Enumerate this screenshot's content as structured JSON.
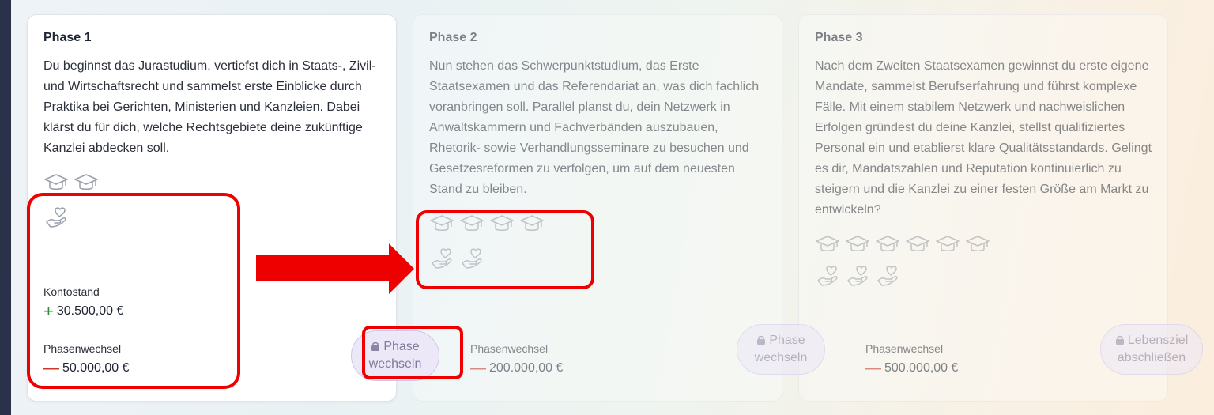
{
  "phases": [
    {
      "title": "Phase 1",
      "text": "Du beginnst das Jurastudium, vertiefst dich in Staats-, Zivil- und Wirtschaftsrecht und sammelst erste Einblicke durch Praktika bei Gerichten, Ministerien und Kanzleien. Dabei klärst du für dich, welche Rechtsgebiete deine zukünftige Kanzlei abdecken soll.",
      "grad_caps": 2,
      "handshakes": 1,
      "balance_label": "Kontostand",
      "balance_value": "30.500,00 €",
      "change_label": "Phasenwechsel",
      "change_value": "50.000,00 €"
    },
    {
      "title": "Phase 2",
      "text": "Nun stehen das Schwerpunktstudium, das Erste Staatsexamen und das Referendariat an, was dich fachlich voranbringen soll. Parallel planst du, dein Netzwerk in Anwaltskammern und Fachverbänden auszubauen, Rhetorik- sowie Verhandlungsseminare zu besuchen und Gesetzesreformen zu verfolgen, um auf dem neuesten Stand zu bleiben.",
      "grad_caps": 4,
      "handshakes": 2,
      "change_label": "Phasenwechsel",
      "change_value": "200.000,00 €"
    },
    {
      "title": "Phase 3",
      "text": "Nach dem Zweiten Staatsexamen gewinnst du erste eigene Mandate, sammelst Berufserfahrung und führst komplexe Fälle. Mit einem stabilem Netzwerk und nachweislichen Erfolgen gründest du deine Kanzlei, stellst qualifiziertes Personal ein und etablierst klare Qualitätsstandards. Gelingt es dir, Mandatszahlen und Reputation kontinuierlich zu steigern und die Kanzlei zu einer festen Größe am Markt zu entwickeln?",
      "grad_caps": 6,
      "handshakes": 3,
      "change_label": "Phasenwechsel",
      "change_value": "500.000,00 €"
    }
  ],
  "buttons": {
    "switch_1_line1": "Phase",
    "switch_1_line2": "wechseln",
    "switch_2_line1": "Phase",
    "switch_2_line2": "wechseln",
    "finish_line1": "Lebensziel",
    "finish_line2": "abschließen"
  },
  "colors": {
    "positive": "#2e8b3e",
    "negative": "#c73a2a",
    "highlight": "#ee0000",
    "button_bg": "#ece8f8"
  },
  "icons": [
    "graduation-cap-icon",
    "handshake-heart-icon",
    "lock-icon",
    "plus-icon",
    "minus-icon",
    "arrow-right-icon"
  ]
}
